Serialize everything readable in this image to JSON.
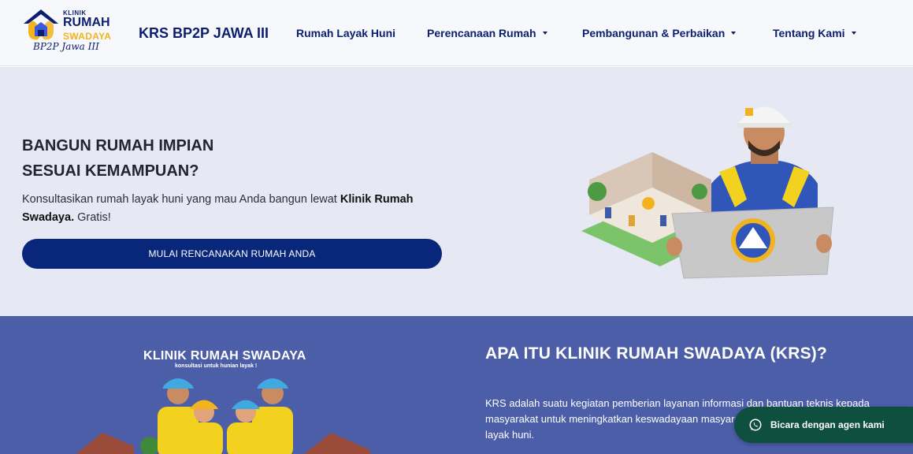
{
  "header": {
    "logo": {
      "line1": "KLINIK",
      "line2": "RUMAH",
      "line3": "SWADAYA",
      "line4": "BP2P Jawa III"
    },
    "brand": "KRS BP2P JAWA III",
    "nav": [
      {
        "label": "Rumah Layak Huni",
        "dropdown": false
      },
      {
        "label": "Perencanaan Rumah",
        "dropdown": true
      },
      {
        "label": "Pembangunan & Perbaikan",
        "dropdown": true
      },
      {
        "label": "Tentang Kami",
        "dropdown": true
      }
    ]
  },
  "hero": {
    "title_line1": "BANGUN RUMAH IMPIAN",
    "title_line2": "SESUAI KEMAMPUAN?",
    "text_before": "Konsultasikan rumah layak huni yang mau Anda bangun lewat ",
    "text_bold": "Klinik Rumah Swadaya.",
    "text_after": " Gratis!",
    "cta": "MULAI RENCANAKAN RUMAH ANDA"
  },
  "about": {
    "illustration_title": "KLINIK RUMAH SWADAYA",
    "illustration_subtitle": "konsultasi untuk hunian layak !",
    "title": "APA ITU KLINIK RUMAH SWADAYA (KRS)?",
    "text": "KRS adalah suatu kegiatan pemberian layanan informasi dan bantuan teknis kepada masyarakat untuk meningkatkan keswadayaan masyarakat dalam pemenuhan rumah layak huni."
  },
  "chat": {
    "label": "Bicara dengan agen kami",
    "icon": "whatsapp-icon"
  },
  "colors": {
    "navy": "#0b1f6e",
    "button": "#08267a",
    "hero_bg": "#e6e8f3",
    "section_bg": "#4c5ea8",
    "gold": "#f2b31e",
    "chat_bg": "#0f4f3f"
  }
}
